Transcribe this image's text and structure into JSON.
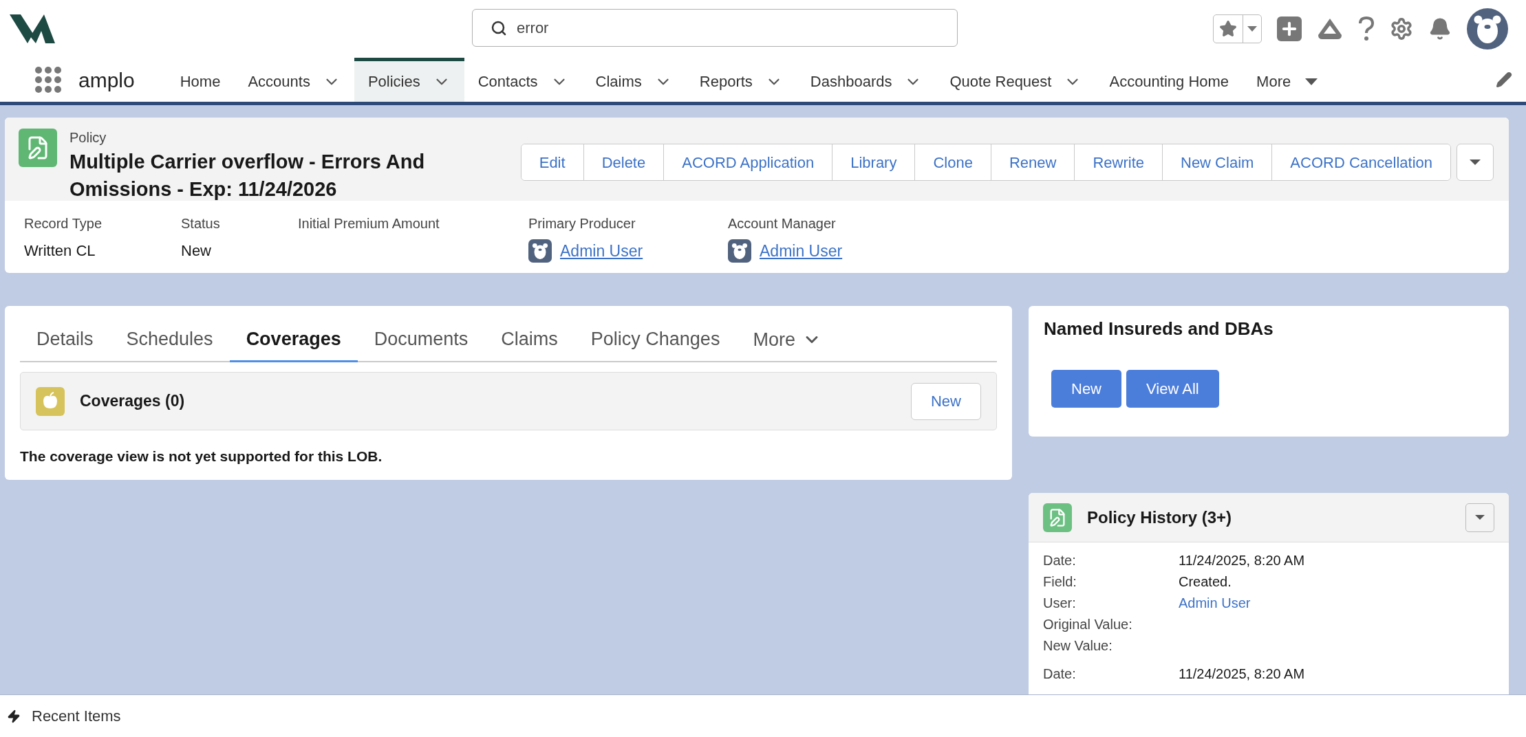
{
  "app": {
    "name": "amplo"
  },
  "search": {
    "value": "error"
  },
  "nav": [
    {
      "label": "Home",
      "menu": false,
      "selected": false
    },
    {
      "label": "Accounts",
      "menu": true,
      "selected": false
    },
    {
      "label": "Policies",
      "menu": true,
      "selected": true
    },
    {
      "label": "Contacts",
      "menu": true,
      "selected": false
    },
    {
      "label": "Claims",
      "menu": true,
      "selected": false
    },
    {
      "label": "Reports",
      "menu": true,
      "selected": false
    },
    {
      "label": "Dashboards",
      "menu": true,
      "selected": false
    },
    {
      "label": "Quote Request",
      "menu": true,
      "selected": false
    },
    {
      "label": "Accounting Home",
      "menu": false,
      "selected": false
    }
  ],
  "nav_more": "More",
  "record": {
    "type_label": "Policy",
    "title": "Multiple Carrier overflow - Errors And Omissions - Exp: 11/24/2026",
    "actions": [
      "Edit",
      "Delete",
      "ACORD Application",
      "Library",
      "Clone",
      "Renew",
      "Rewrite",
      "New Claim",
      "ACORD Cancellation"
    ],
    "fields": [
      {
        "label": "Record Type",
        "value": "Written CL",
        "kind": "text"
      },
      {
        "label": "Status",
        "value": "New",
        "kind": "text"
      },
      {
        "label": "Initial Premium Amount",
        "kind": "empty"
      },
      {
        "label": "Primary Producer",
        "value": "Admin User",
        "kind": "user"
      },
      {
        "label": "Account Manager",
        "value": "Admin User",
        "kind": "user"
      }
    ]
  },
  "tabs": [
    {
      "label": "Details",
      "selected": false
    },
    {
      "label": "Schedules",
      "selected": false
    },
    {
      "label": "Coverages",
      "selected": true
    },
    {
      "label": "Documents",
      "selected": false
    },
    {
      "label": "Claims",
      "selected": false
    },
    {
      "label": "Policy Changes",
      "selected": false
    }
  ],
  "tabs_more": "More",
  "coverages": {
    "title": "Coverages (0)",
    "button": "New",
    "message": "The coverage view is not yet supported for this LOB."
  },
  "named_insureds": {
    "title": "Named Insureds and DBAs",
    "buttons": [
      "New",
      "View All"
    ]
  },
  "policy_history": {
    "title": "Policy History (3+)",
    "entries": [
      [
        {
          "label": "Date:",
          "value": "11/24/2025, 8:20 AM",
          "kind": "text"
        },
        {
          "label": "Field:",
          "value": "Created.",
          "kind": "text"
        },
        {
          "label": "User:",
          "value": "Admin User",
          "kind": "link"
        },
        {
          "label": "Original Value:",
          "kind": "empty"
        },
        {
          "label": "New Value:",
          "kind": "empty"
        }
      ],
      [
        {
          "label": "Date:",
          "value": "11/24/2025, 8:20 AM",
          "kind": "text"
        }
      ]
    ]
  },
  "footer": {
    "label": "Recent Items"
  }
}
